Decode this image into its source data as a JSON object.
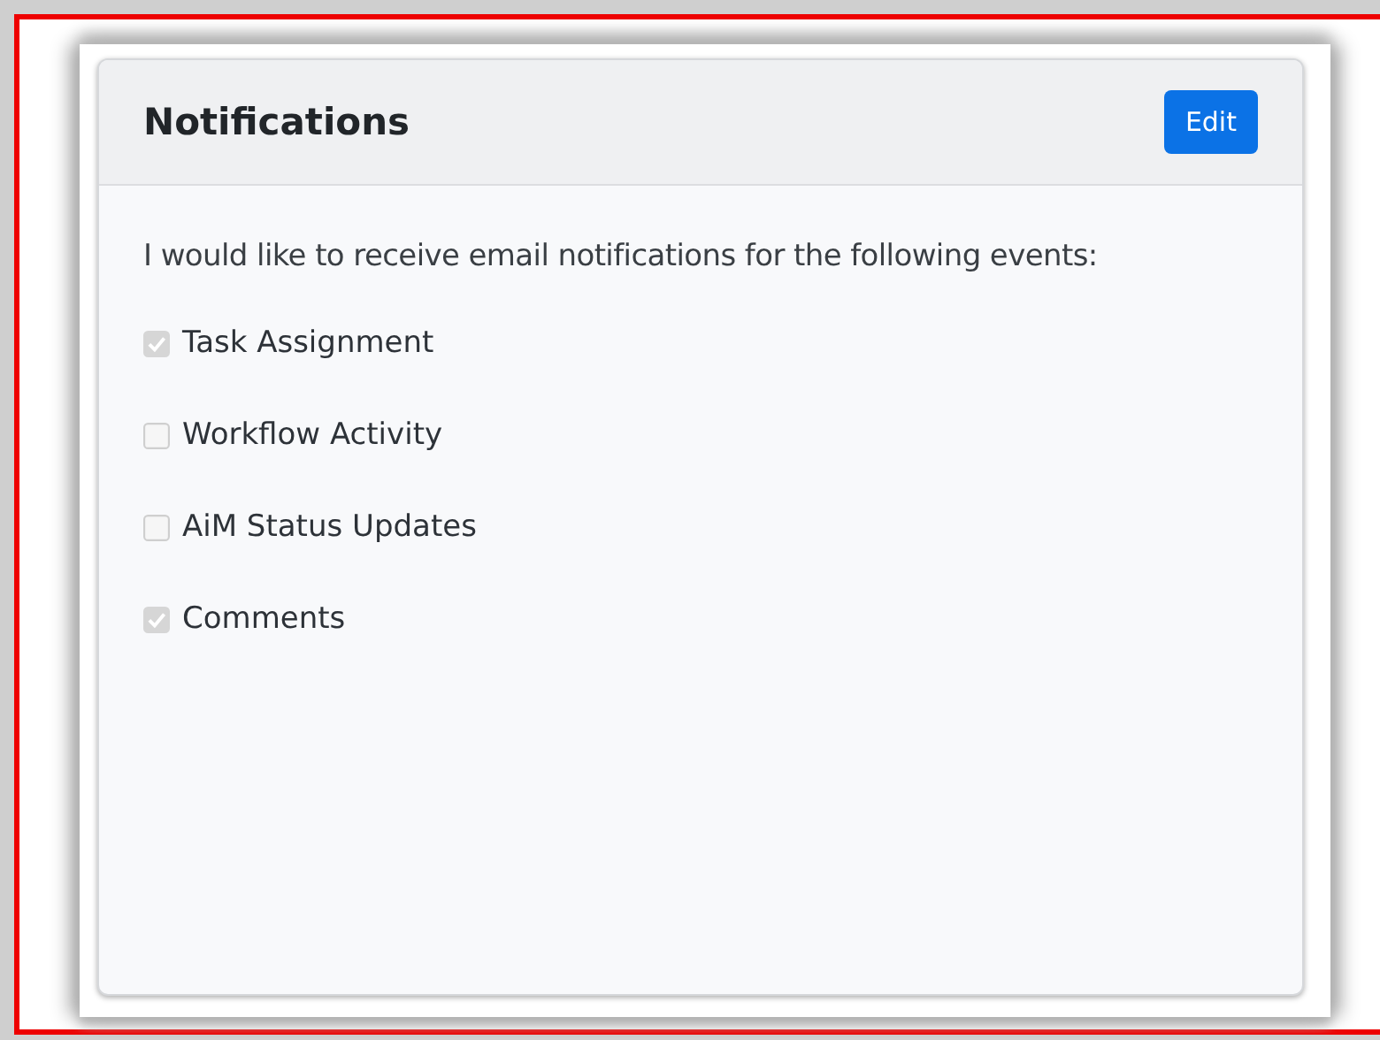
{
  "card": {
    "title": "Notifications",
    "edit_button": "Edit",
    "intro": "I would like to receive email notifications for the following events:",
    "options": [
      {
        "label": "Task Assignment",
        "checked": true
      },
      {
        "label": "Workflow Activity",
        "checked": false
      },
      {
        "label": "AiM Status Updates",
        "checked": false
      },
      {
        "label": "Comments",
        "checked": true
      }
    ]
  }
}
